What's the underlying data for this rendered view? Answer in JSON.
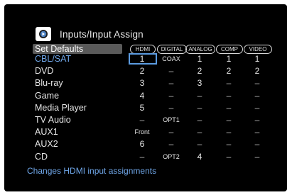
{
  "header": {
    "title": "Inputs/Input Assign",
    "icon": "input-assign-icon"
  },
  "menu": {
    "set_defaults": "Set Defaults"
  },
  "columns": [
    "HDMI",
    "DIGITAL",
    "ANALOG",
    "COMP",
    "VIDEO"
  ],
  "rows": [
    {
      "label": "CBL/SAT",
      "cells": [
        "1",
        "COAX",
        "1",
        "1",
        "1"
      ],
      "selected": true
    },
    {
      "label": "DVD",
      "cells": [
        "2",
        "–",
        "2",
        "2",
        "2"
      ]
    },
    {
      "label": "Blu-ray",
      "cells": [
        "3",
        "–",
        "3",
        "–",
        "–"
      ]
    },
    {
      "label": "Game",
      "cells": [
        "4",
        "–",
        "–",
        "–",
        "–"
      ]
    },
    {
      "label": "Media Player",
      "cells": [
        "5",
        "–",
        "–",
        "–",
        "–"
      ]
    },
    {
      "label": "TV Audio",
      "cells": [
        "–",
        "OPT1",
        "–",
        "–",
        "–"
      ]
    },
    {
      "label": "AUX1",
      "cells": [
        "Front",
        "–",
        "–",
        "–",
        "–"
      ]
    },
    {
      "label": "AUX2",
      "cells": [
        "6",
        "–",
        "–",
        "–",
        "–"
      ]
    },
    {
      "label": "CD",
      "cells": [
        "–",
        "OPT2",
        "4",
        "–",
        "–"
      ]
    }
  ],
  "footer": {
    "help": "Changes HDMI input assignments"
  },
  "colors": {
    "accent": "#6fa6e8",
    "focus": "#5b9be0",
    "background": "#000000",
    "header_bar": "#5a5a5a"
  }
}
